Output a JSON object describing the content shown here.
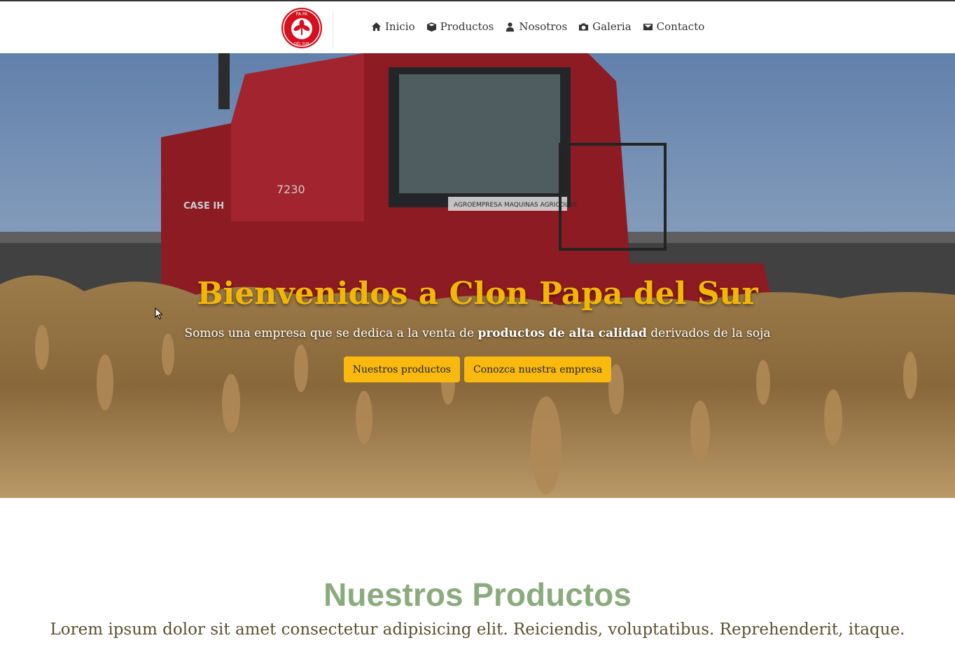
{
  "logo": {
    "top_text": "PA PA",
    "bottom_text": "DEL SUR",
    "color": "#d6101e"
  },
  "nav": {
    "items": [
      {
        "label": "Inicio",
        "icon": "home-icon"
      },
      {
        "label": "Productos",
        "icon": "box-icon"
      },
      {
        "label": "Nosotros",
        "icon": "user-icon"
      },
      {
        "label": "Galeria",
        "icon": "camera-icon"
      },
      {
        "label": "Contacto",
        "icon": "envelope-icon"
      }
    ]
  },
  "hero": {
    "title": "Bienvenidos a Clon Papa del Sur",
    "subtitle_pre": "Somos una empresa que se dedica a la venta de ",
    "subtitle_bold": "productos de alta calidad",
    "subtitle_post": " derivados de la soja",
    "buttons": {
      "products": "Nuestros productos",
      "company": "Conozca nuestra empresa"
    },
    "machine_brand": "CASE IH",
    "machine_model": "7230",
    "machine_banner": "AGROEMPRESA MAQUINAS AGRICOLAS"
  },
  "products": {
    "title": "Nuestros Productos",
    "text": "Lorem ipsum dolor sit amet consectetur adipisicing elit. Reiciendis, voluptatibus. Reprehenderit, itaque."
  },
  "colors": {
    "accent": "#f9b90f",
    "title_yellow": "#f2b705",
    "section_green": "#8aab7d",
    "text_brown": "#5b5030"
  }
}
